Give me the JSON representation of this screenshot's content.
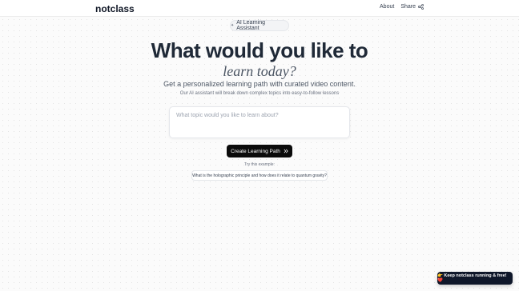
{
  "header": {
    "logo": "notclass",
    "nav": {
      "about": "About",
      "share": "Share"
    }
  },
  "hero": {
    "badge_icon": "sparkle-icon",
    "badge": "AI Learning Assistant",
    "title_line1": "What would you like to",
    "title_line2": "learn today?",
    "subtitle": "Get a personalized learning path with curated video content.",
    "description": "Our AI assistant will break down complex topics into easy-to-follow lessons"
  },
  "form": {
    "topic_placeholder": "What topic would you like to learn about?",
    "topic_value": "",
    "submit_label": "Create Learning Path",
    "submit_icon": "double-chevron-right-icon"
  },
  "examples": {
    "label": "Try this example:",
    "items": [
      "What is the holographic principle and how does it relate to quantum gravity?"
    ]
  },
  "support": {
    "label": "👉 Keep notclass running & free! ❤️"
  },
  "colors": {
    "primary_button": "#0b0b0b",
    "support_button": "#0f172a",
    "title": "#1f2937"
  }
}
